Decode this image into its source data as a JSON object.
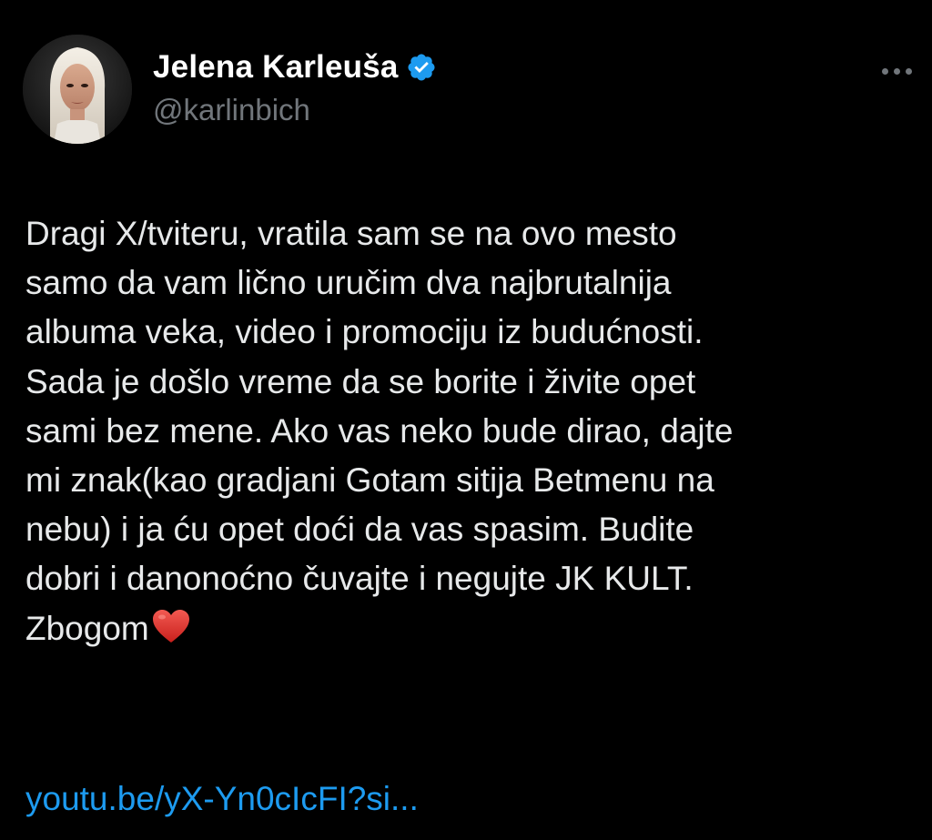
{
  "author": {
    "display_name": "Jelena Karleuša",
    "handle": "@karlinbich",
    "verified": true,
    "avatar_icon": "profile-photo"
  },
  "more_icon": "more-horizontal-icon",
  "tweet": {
    "lines": [
      "Dragi X/tviteru, vratila sam se na ovo mesto",
      "samo da vam lično uručim dva najbrutalnija",
      "albuma veka, video i promociju iz budućnosti.",
      "Sada je došlo vreme da se borite i živite opet",
      "sami bez mene. Ako vas neko bude dirao, dajte",
      "mi znak(kao gradjani Gotam sitija Betmenu na",
      "nebu) i ja ću opet doći da vas spasim. Budite",
      "dobri i danonoćno čuvajte i negujte JK KULT.",
      "Zbogom"
    ],
    "end_emoji": "red-heart-icon",
    "link": "youtu.be/yX-Yn0cIcFI?si..."
  },
  "colors": {
    "background": "#000000",
    "text": "#e7e9ea",
    "secondary": "#71767b",
    "link": "#1d9bf0",
    "verified": "#1d9bf0",
    "heart": "#e0332e"
  }
}
